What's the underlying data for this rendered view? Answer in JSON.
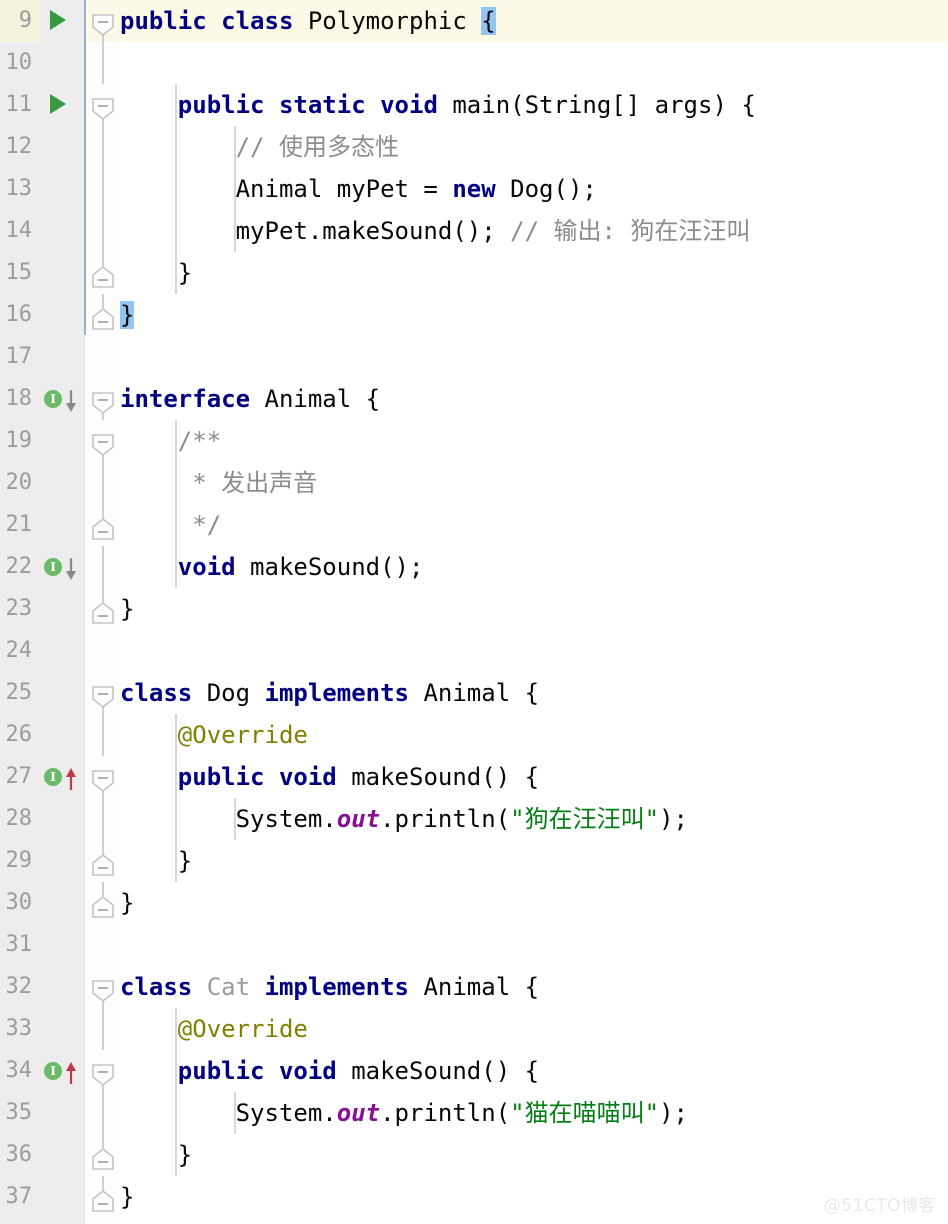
{
  "app": {
    "kind": "code-editor",
    "language": "Java",
    "theme": "IntelliJ Light"
  },
  "colors": {
    "keyword": "#000080",
    "comment": "#8c8c8c",
    "string": "#067d17",
    "annotation": "#808000",
    "static_field": "#871094",
    "gutter_bg": "#ededed",
    "editor_bg": "#ffffff",
    "current_line_bg": "#fcfae6",
    "brace_match_bg": "#93c5f0",
    "run_icon": "#369a42",
    "impl_icon": "#6aba6a",
    "override_arrow": "#c1384a",
    "implemented_arrow": "#8a8a8a",
    "block_bar": "#93b3c9"
  },
  "watermark": "@51CTO博客",
  "lines": [
    {
      "num": "9",
      "current": true,
      "gutter_icon": "run-arrow",
      "fold": "start",
      "indent_guides": [],
      "tokens": [
        {
          "t": "public ",
          "c": "kw"
        },
        {
          "t": "class ",
          "c": "kw"
        },
        {
          "t": "Polymorphic ",
          "c": ""
        },
        {
          "t": "{",
          "c": "brace-hl"
        }
      ]
    },
    {
      "num": "10",
      "current": false,
      "gutter_icon": "",
      "fold": "line",
      "indent_guides": [],
      "tokens": []
    },
    {
      "num": "11",
      "current": false,
      "gutter_icon": "run-arrow",
      "fold": "start",
      "indent_guides": [
        175
      ],
      "tokens": [
        {
          "t": "    ",
          "c": ""
        },
        {
          "t": "public ",
          "c": "kw"
        },
        {
          "t": "static ",
          "c": "kw"
        },
        {
          "t": "void ",
          "c": "kw"
        },
        {
          "t": "main(String[] args) {",
          "c": ""
        }
      ]
    },
    {
      "num": "12",
      "current": false,
      "gutter_icon": "",
      "fold": "line",
      "indent_guides": [
        175,
        234
      ],
      "tokens": [
        {
          "t": "        ",
          "c": ""
        },
        {
          "t": "// 使用多态性",
          "c": "cmt"
        }
      ]
    },
    {
      "num": "13",
      "current": false,
      "gutter_icon": "",
      "fold": "line",
      "indent_guides": [
        175,
        234
      ],
      "tokens": [
        {
          "t": "        Animal myPet = ",
          "c": ""
        },
        {
          "t": "new ",
          "c": "kw"
        },
        {
          "t": "Dog();",
          "c": ""
        }
      ]
    },
    {
      "num": "14",
      "current": false,
      "gutter_icon": "",
      "fold": "line",
      "indent_guides": [
        175,
        234
      ],
      "tokens": [
        {
          "t": "        myPet.makeSound(); ",
          "c": ""
        },
        {
          "t": "// 输出: 狗在汪汪叫",
          "c": "cmt"
        }
      ]
    },
    {
      "num": "15",
      "current": false,
      "gutter_icon": "",
      "fold": "end",
      "indent_guides": [
        175
      ],
      "tokens": [
        {
          "t": "    }",
          "c": ""
        }
      ]
    },
    {
      "num": "16",
      "current": false,
      "gutter_icon": "",
      "fold": "end",
      "indent_guides": [],
      "tokens": [
        {
          "t": "}",
          "c": "brace-hl"
        }
      ]
    },
    {
      "num": "17",
      "current": false,
      "gutter_icon": "",
      "fold": "none",
      "indent_guides": [],
      "tokens": []
    },
    {
      "num": "18",
      "current": false,
      "gutter_icon": "impl-down",
      "fold": "start",
      "indent_guides": [],
      "tokens": [
        {
          "t": "interface ",
          "c": "kw"
        },
        {
          "t": "Animal {",
          "c": ""
        }
      ]
    },
    {
      "num": "19",
      "current": false,
      "gutter_icon": "",
      "fold": "start",
      "indent_guides": [
        175
      ],
      "tokens": [
        {
          "t": "    ",
          "c": ""
        },
        {
          "t": "/**",
          "c": "cmt"
        }
      ]
    },
    {
      "num": "20",
      "current": false,
      "gutter_icon": "",
      "fold": "line",
      "indent_guides": [
        175
      ],
      "tokens": [
        {
          "t": "     ",
          "c": ""
        },
        {
          "t": "* 发出声音",
          "c": "cmt"
        }
      ]
    },
    {
      "num": "21",
      "current": false,
      "gutter_icon": "",
      "fold": "end",
      "indent_guides": [
        175
      ],
      "tokens": [
        {
          "t": "     ",
          "c": ""
        },
        {
          "t": "*/",
          "c": "cmt"
        }
      ]
    },
    {
      "num": "22",
      "current": false,
      "gutter_icon": "impl-down",
      "fold": "line",
      "indent_guides": [
        175
      ],
      "tokens": [
        {
          "t": "    ",
          "c": ""
        },
        {
          "t": "void ",
          "c": "kw"
        },
        {
          "t": "makeSound();",
          "c": ""
        }
      ]
    },
    {
      "num": "23",
      "current": false,
      "gutter_icon": "",
      "fold": "end",
      "indent_guides": [],
      "tokens": [
        {
          "t": "}",
          "c": ""
        }
      ]
    },
    {
      "num": "24",
      "current": false,
      "gutter_icon": "",
      "fold": "none",
      "indent_guides": [],
      "tokens": []
    },
    {
      "num": "25",
      "current": false,
      "gutter_icon": "",
      "fold": "start",
      "indent_guides": [],
      "tokens": [
        {
          "t": "class ",
          "c": "kw"
        },
        {
          "t": "Dog ",
          "c": ""
        },
        {
          "t": "implements ",
          "c": "kw"
        },
        {
          "t": "Animal {",
          "c": ""
        }
      ]
    },
    {
      "num": "26",
      "current": false,
      "gutter_icon": "",
      "fold": "line",
      "indent_guides": [
        175
      ],
      "tokens": [
        {
          "t": "    ",
          "c": ""
        },
        {
          "t": "@Override",
          "c": "ann"
        }
      ]
    },
    {
      "num": "27",
      "current": false,
      "gutter_icon": "impl-up",
      "fold": "start",
      "indent_guides": [
        175
      ],
      "tokens": [
        {
          "t": "    ",
          "c": ""
        },
        {
          "t": "public ",
          "c": "kw"
        },
        {
          "t": "void ",
          "c": "kw"
        },
        {
          "t": "makeSound() {",
          "c": ""
        }
      ]
    },
    {
      "num": "28",
      "current": false,
      "gutter_icon": "",
      "fold": "line",
      "indent_guides": [
        175,
        234
      ],
      "tokens": [
        {
          "t": "        System.",
          "c": ""
        },
        {
          "t": "out",
          "c": "stat"
        },
        {
          "t": ".println(",
          "c": ""
        },
        {
          "t": "\"狗在汪汪叫\"",
          "c": "str"
        },
        {
          "t": ");",
          "c": ""
        }
      ]
    },
    {
      "num": "29",
      "current": false,
      "gutter_icon": "",
      "fold": "end",
      "indent_guides": [
        175
      ],
      "tokens": [
        {
          "t": "    }",
          "c": ""
        }
      ]
    },
    {
      "num": "30",
      "current": false,
      "gutter_icon": "",
      "fold": "end",
      "indent_guides": [],
      "tokens": [
        {
          "t": "}",
          "c": ""
        }
      ]
    },
    {
      "num": "31",
      "current": false,
      "gutter_icon": "",
      "fold": "none",
      "indent_guides": [],
      "tokens": []
    },
    {
      "num": "32",
      "current": false,
      "gutter_icon": "",
      "fold": "start",
      "indent_guides": [],
      "tokens": [
        {
          "t": "class ",
          "c": "kw"
        },
        {
          "t": "Cat ",
          "c": "gray"
        },
        {
          "t": "implements ",
          "c": "kw"
        },
        {
          "t": "Animal {",
          "c": ""
        }
      ]
    },
    {
      "num": "33",
      "current": false,
      "gutter_icon": "",
      "fold": "line",
      "indent_guides": [
        175
      ],
      "tokens": [
        {
          "t": "    ",
          "c": ""
        },
        {
          "t": "@Override",
          "c": "ann"
        }
      ]
    },
    {
      "num": "34",
      "current": false,
      "gutter_icon": "impl-up",
      "fold": "start",
      "indent_guides": [
        175
      ],
      "tokens": [
        {
          "t": "    ",
          "c": ""
        },
        {
          "t": "public ",
          "c": "kw"
        },
        {
          "t": "void ",
          "c": "kw"
        },
        {
          "t": "makeSound() {",
          "c": ""
        }
      ]
    },
    {
      "num": "35",
      "current": false,
      "gutter_icon": "",
      "fold": "line",
      "indent_guides": [
        175,
        234
      ],
      "tokens": [
        {
          "t": "        System.",
          "c": ""
        },
        {
          "t": "out",
          "c": "stat"
        },
        {
          "t": ".println(",
          "c": ""
        },
        {
          "t": "\"猫在喵喵叫\"",
          "c": "str"
        },
        {
          "t": ");",
          "c": ""
        }
      ]
    },
    {
      "num": "36",
      "current": false,
      "gutter_icon": "",
      "fold": "end",
      "indent_guides": [
        175
      ],
      "tokens": [
        {
          "t": "    }",
          "c": ""
        }
      ]
    },
    {
      "num": "37",
      "current": false,
      "gutter_icon": "",
      "fold": "end",
      "indent_guides": [],
      "tokens": [
        {
          "t": "}",
          "c": ""
        }
      ]
    }
  ]
}
